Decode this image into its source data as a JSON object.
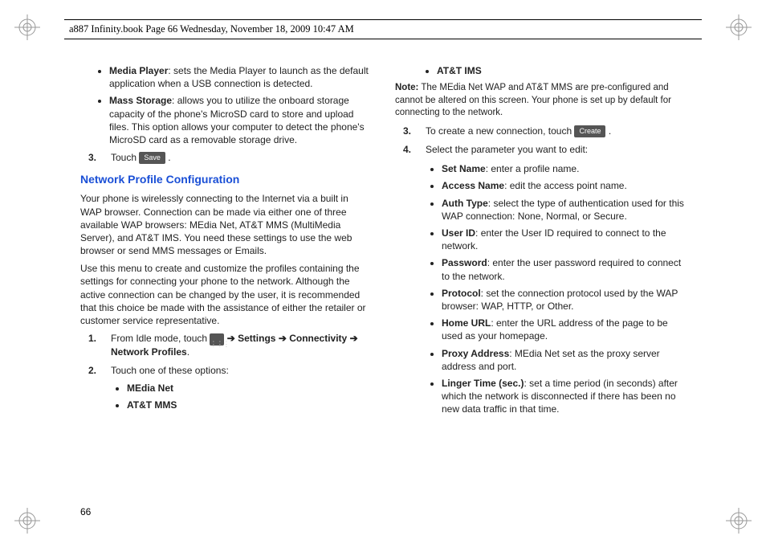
{
  "header": "a887 Infinity.book  Page 66  Wednesday, November 18, 2009  10:47 AM",
  "pageNumber": "66",
  "left": {
    "bullets1": [
      {
        "term": "Media Player",
        "desc": ": sets the Media Player to launch as the default application when a USB connection is detected."
      },
      {
        "term": "Mass Storage",
        "desc": ": allows you to utilize the onboard storage capacity of the phone's MicroSD card to store and upload files. This option allows your computer to detect the phone's MicroSD card as a removable storage drive."
      }
    ],
    "step3_prefix": "3.",
    "step3_text_a": "Touch ",
    "save_label": "Save",
    "step3_text_b": ".",
    "section_title": "Network Profile Configuration",
    "para1": "Your phone is wirelessly connecting to the Internet via a built in WAP browser. Connection can be made via either one of three available WAP browsers: MEdia Net, AT&T MMS (MultiMedia Server), and AT&T IMS. You need these settings to use the web browser or send MMS messages or Emails.",
    "para2": "Use this menu to create and customize the profiles containing the settings for connecting your phone to the network. Although the active connection can be changed by the user, it is recommended that this choice be made with the assistance of either the retailer or customer service representative.",
    "step1_prefix": "1.",
    "step1_a": "From Idle mode, touch ",
    "step1_menu": "Menu",
    "step1_b_arrow": " ➔ ",
    "step1_settings": "Settings",
    "step1_conn": "Connectivity",
    "step1_np": "Network Profiles",
    "step1_end": ".",
    "step2_prefix": "2.",
    "step2_text": "Touch one of these options:",
    "options": [
      "MEdia Net",
      "AT&T MMS"
    ]
  },
  "right": {
    "top_bullet": "AT&T IMS",
    "note_label": "Note:",
    "note_text": " The MEdia Net WAP and AT&T MMS are pre-configured and cannot be altered on this screen. Your phone is set up by default for connecting to the network.",
    "step3_prefix": "3.",
    "step3_a": "To create a new connection, touch ",
    "create_label": "Create",
    "step3_b": ".",
    "step4_prefix": "4.",
    "step4_text": "Select the parameter you want to edit:",
    "params": [
      {
        "term": "Set Name",
        "desc": ": enter a profile name."
      },
      {
        "term": "Access Name",
        "desc": ": edit the access point name."
      },
      {
        "term": "Auth Type",
        "desc": ": select the type of authentication used for this WAP connection: None, Normal, or Secure."
      },
      {
        "term": "User ID",
        "desc": ": enter the User ID required to connect to the network."
      },
      {
        "term": "Password",
        "desc": ": enter the user password required to connect to the network."
      },
      {
        "term": "Protocol",
        "desc": ": set the connection protocol used by the WAP browser: WAP, HTTP, or Other."
      },
      {
        "term": "Home URL",
        "desc": ": enter the URL address of the page to be used as your homepage."
      },
      {
        "term": "Proxy Address",
        "desc": ": MEdia Net set as the proxy server address and port."
      },
      {
        "term": "Linger Time (sec.)",
        "desc": ": set a time period (in seconds) after which the network is disconnected if there has been no new data traffic in that time."
      }
    ]
  }
}
